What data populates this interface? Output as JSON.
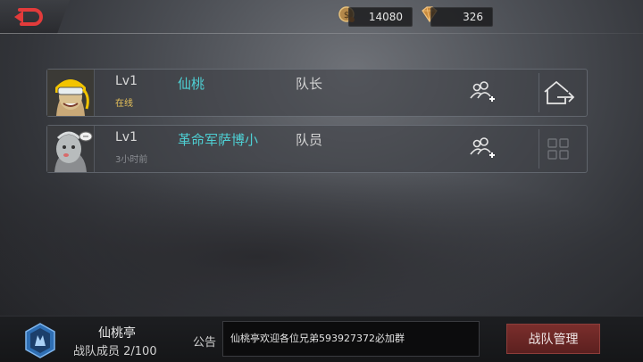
{
  "header": {
    "coins": "14080",
    "gems": "326",
    "accent_red": "#e23b3b"
  },
  "members": [
    {
      "level": "Lv1",
      "status": "在线",
      "name": "仙桃",
      "role": "队长",
      "action_icon": "leave-house-icon"
    },
    {
      "level": "Lv1",
      "status": "3小时前",
      "name": "革命军萨博小",
      "role": "队员",
      "action_icon": "grid-icon"
    }
  ],
  "footer": {
    "team_name": "仙桃亭",
    "member_count": "战队成员 2/100",
    "notice_label": "公告",
    "notice_text": "仙桃亭欢迎各位兄弟593927372必加群",
    "manage_button": "战队管理"
  }
}
